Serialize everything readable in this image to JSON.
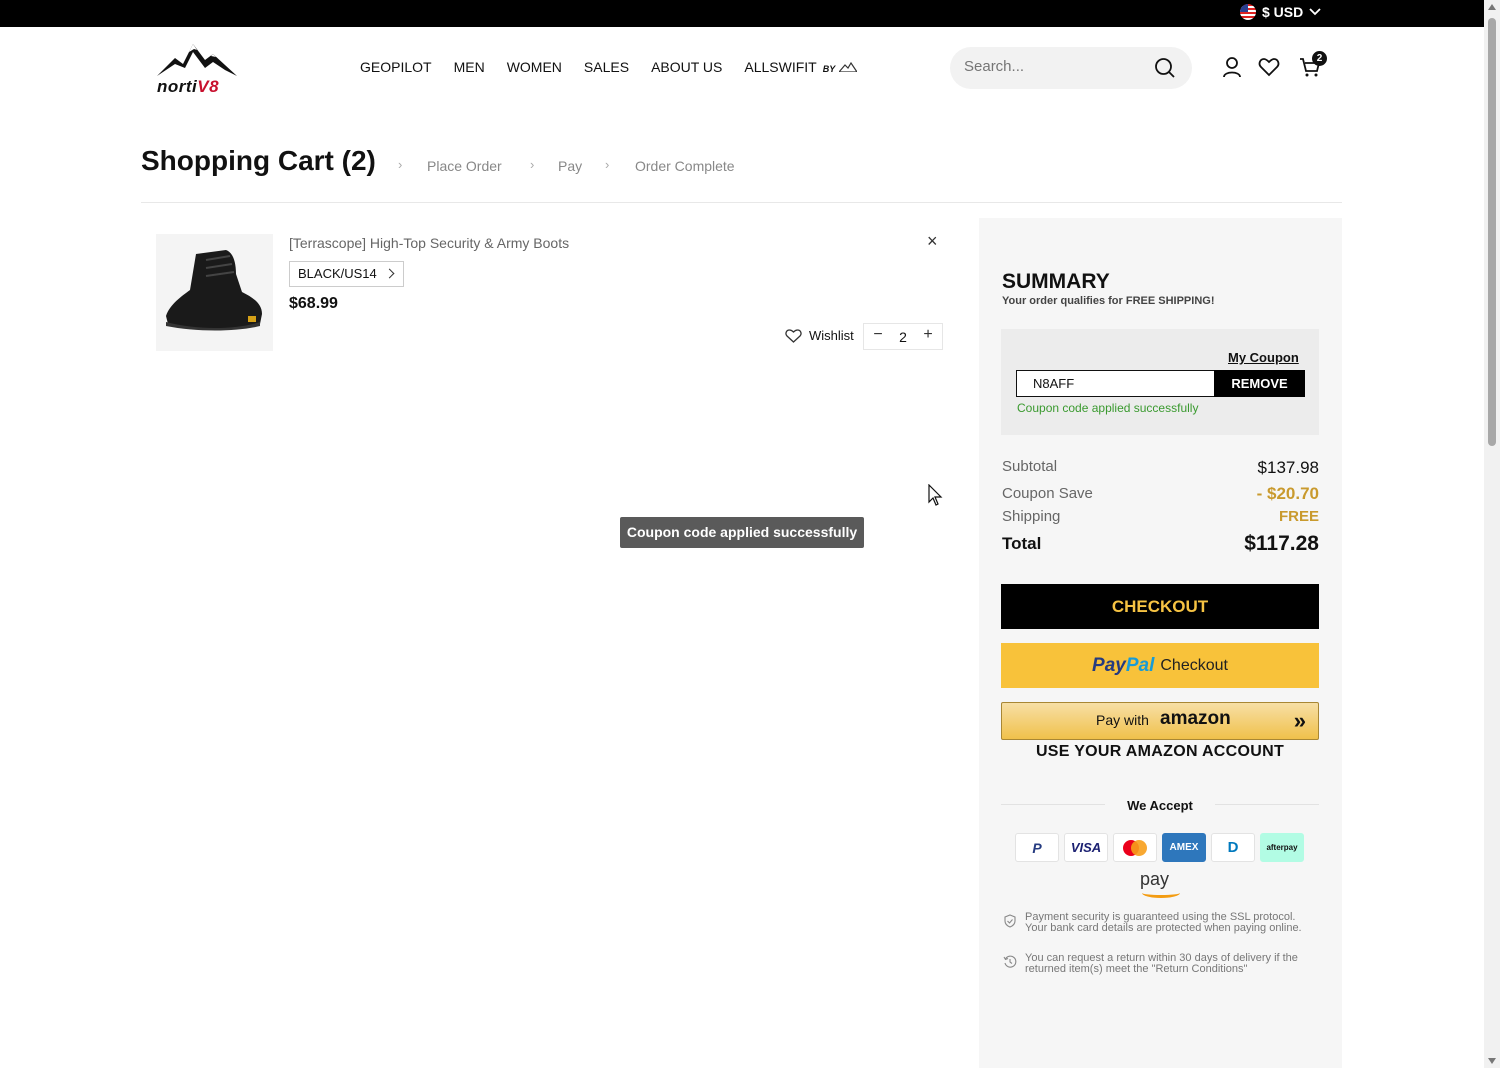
{
  "topbar": {
    "currency": "$ USD"
  },
  "brand": {
    "name_a": "norti",
    "name_b": "V8"
  },
  "nav": {
    "items": [
      "GEOPILOT",
      "MEN",
      "WOMEN",
      "SALES",
      "ABOUT US",
      "ALLSWIFIT"
    ],
    "allswifit_suffix": "BY"
  },
  "search": {
    "placeholder": "Search..."
  },
  "header": {
    "cart_count": "2"
  },
  "steps": {
    "title": "Shopping Cart (2)",
    "items": [
      "Place Order",
      "Pay",
      "Order Complete"
    ]
  },
  "cart": {
    "item": {
      "name": "[Terrascope] High-Top Security & Army Boots",
      "variant": "BLACK/US14",
      "price": "$68.99",
      "wishlist_label": "Wishlist",
      "quantity": "2",
      "remove": "×"
    }
  },
  "toast": {
    "message": "Coupon code applied successfully"
  },
  "summary": {
    "title": "SUMMARY",
    "subtitle": "Your order qualifies for FREE SHIPPING!",
    "coupon": {
      "link": "My Coupon",
      "code": "N8AFF",
      "remove_label": "REMOVE",
      "message": "Coupon code applied successfully"
    },
    "rows": {
      "subtotal_label": "Subtotal",
      "subtotal_value": "$137.98",
      "coupon_label": "Coupon Save",
      "coupon_value": "- $20.70",
      "shipping_label": "Shipping",
      "shipping_value": "FREE",
      "total_label": "Total",
      "total_value": "$117.28"
    },
    "checkout_label": "CHECKOUT",
    "paypal": {
      "brand_a": "Pay",
      "brand_b": "Pal",
      "label": "Checkout"
    },
    "amazon": {
      "label": "Pay with",
      "brand": "amazon",
      "arrows": "»",
      "account": "USE YOUR AMAZON ACCOUNT"
    },
    "we_accept": "We Accept",
    "cards": [
      "P",
      "VISA",
      "●●",
      "AMEX",
      "D",
      "afterpay"
    ],
    "amazon_pay": "pay",
    "notes": [
      "Payment security is guaranteed using the SSL protocol. Your bank card details are protected when paying online.",
      "You can request a return within 30 days of delivery if the returned item(s) meet the \"Return Conditions\""
    ]
  },
  "colors": {
    "accent_gold": "#f6c343",
    "paypal_yellow": "#f8c23a",
    "success_green": "#3a9a2f",
    "discount_gold": "#c99a2e",
    "brand_red": "#c8102e"
  }
}
